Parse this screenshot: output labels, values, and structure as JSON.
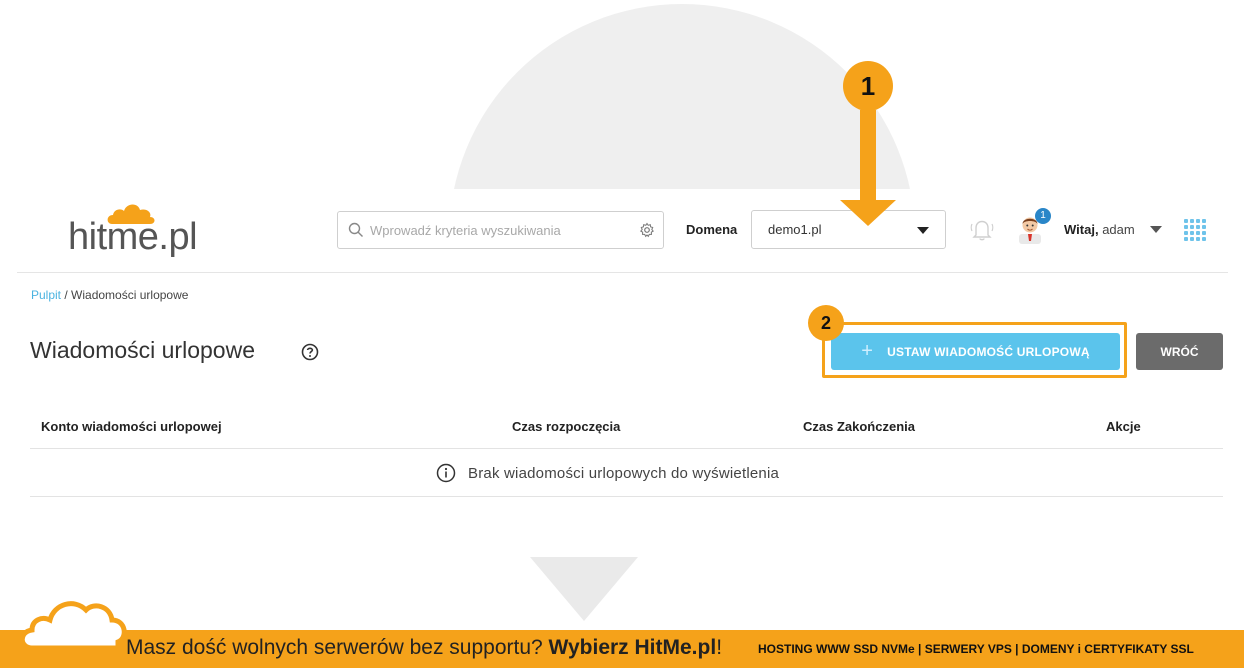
{
  "header": {
    "logo_text": "hitme.pl",
    "search_placeholder": "Wprowadź kryteria wyszukiwania",
    "domain_label": "Domena",
    "domain_value": "demo1.pl",
    "notifications_badge": "1",
    "greeting_bold": "Witaj,",
    "greeting_user": "adam"
  },
  "breadcrumb": {
    "root": "Pulpit",
    "separator": " / ",
    "current": "Wiadomości urlopowe"
  },
  "page": {
    "title": "Wiadomości urlopowe",
    "primary_button": "USTAW WIADOMOŚĆ URLOPOWĄ",
    "back_button": "WRÓĆ"
  },
  "table": {
    "columns": [
      "Konto wiadomości urlopowej",
      "Czas rozpoczęcia",
      "Czas Zakończenia",
      "Akcje"
    ],
    "empty_message": "Brak wiadomości urlopowych do wyświetlenia"
  },
  "annotations": {
    "step1": "1",
    "step2": "2"
  },
  "footer": {
    "slogan_prefix": "Masz dość wolnych serwerów bez supportu?",
    "slogan_brand": "Wybierz HitMe.pl",
    "slogan_suffix": "!",
    "services": "HOSTING WWW SSD NVMe | SERWERY VPS | DOMENY i CERTYFIKATY SSL"
  },
  "colors": {
    "accent_orange": "#f5a21a",
    "primary_blue": "#5bc4ec",
    "link_blue": "#4ab3e0",
    "back_gray": "#6b6b6b"
  }
}
